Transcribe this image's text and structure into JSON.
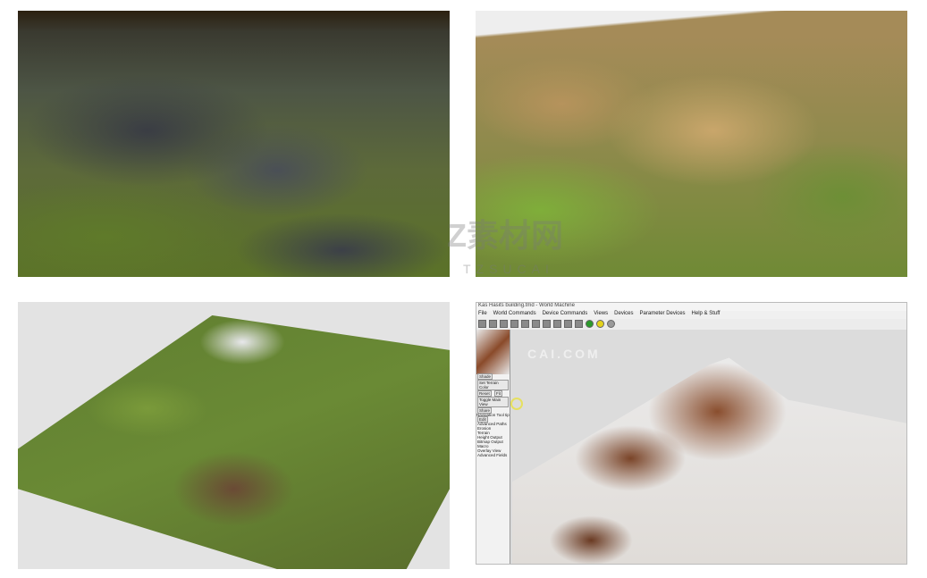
{
  "panels": [
    {
      "label": "dark rocky mountain terrain render"
    },
    {
      "label": "sandy green mountain terrain render"
    },
    {
      "label": "terrain tile with snow peaks and rivers"
    },
    {
      "label": "World Machine editor"
    }
  ],
  "world_machine": {
    "title": "Kas Hasits building.tmd - World Machine",
    "menu": [
      "File",
      "World Commands",
      "Device Commands",
      "Views",
      "Devices",
      "Parameter Devices",
      "Help & Stuff"
    ],
    "left_buttons": [
      "Shade",
      "Reset",
      "Fit",
      "Toggle Main View",
      "Share"
    ],
    "left_labels": {
      "color": "Set Terrain Color",
      "navigation": "Navigation",
      "tooltip": "Tool tip",
      "edit": "Edit"
    },
    "devices": [
      "Advanced Paths",
      "Erosion",
      "Terrain",
      "Height Output",
      "Bitmap Output",
      "Macro",
      "Overlay View",
      "Advanced Fields"
    ]
  },
  "watermark": {
    "brand": "Z素材网",
    "url_top": "TZSUCAI",
    "url": "CAI.COM"
  }
}
